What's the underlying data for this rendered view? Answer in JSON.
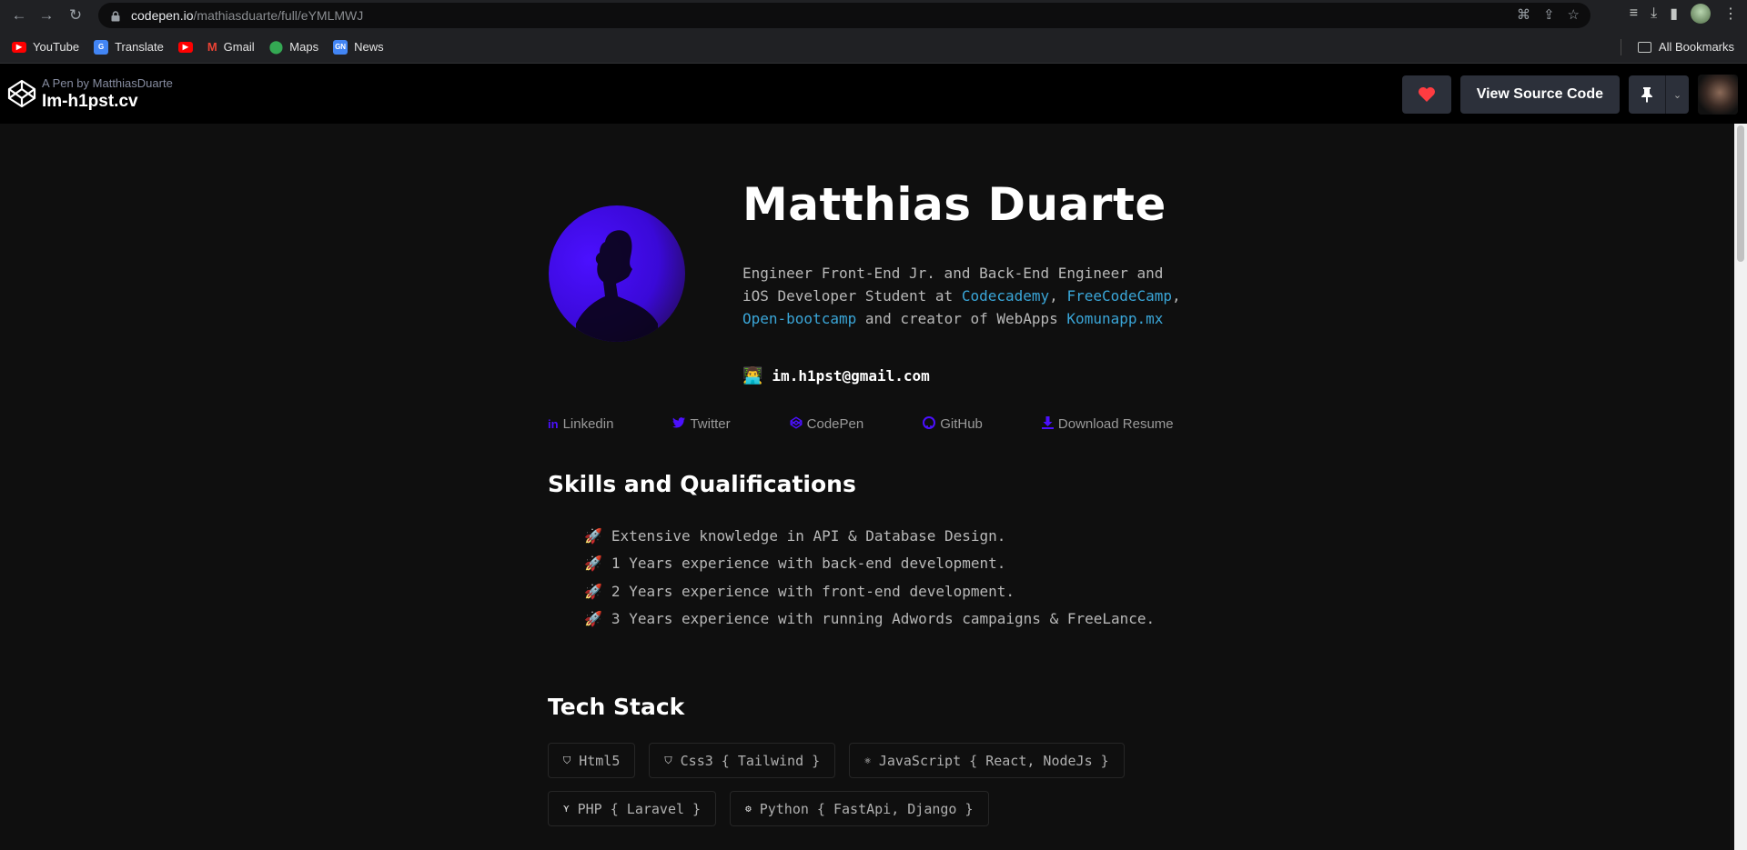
{
  "browser": {
    "url_host": "codepen.io",
    "url_path": "/mathiasduarte/full/eYMLMWJ"
  },
  "bookmarks": {
    "items": [
      {
        "label": "YouTube",
        "color": "#ff0000"
      },
      {
        "label": "Translate",
        "color": "#4285f4"
      },
      {
        "label": "",
        "color": "#ff0000"
      },
      {
        "label": "Gmail",
        "color": "#ea4335"
      },
      {
        "label": "Maps",
        "color": "#34a853"
      },
      {
        "label": "News",
        "color": "#4285f4"
      }
    ],
    "all_label": "All Bookmarks"
  },
  "header": {
    "by_line": "A Pen by MatthiasDuarte",
    "title": "Im-h1pst.cv",
    "view_source": "View Source Code"
  },
  "profile": {
    "name": "Matthias Duarte",
    "bio_1": "Engineer Front-End Jr. and Back-End Engineer and iOS Developer Student at ",
    "bio_link_1": "Codecademy",
    "bio_comma": ",",
    "bio_link_2": "FreeCodeCamp",
    "bio_sep": ", ",
    "bio_link_3": "Open-bootcamp",
    "bio_2": " and creator of WebApps ",
    "bio_link_4": "Komunapp.mx",
    "email": "im.h1pst@gmail.com",
    "accent_color": "#4b10ff",
    "link_color": "#3aa6d8"
  },
  "links": [
    {
      "icon": "linkedin-icon",
      "glyph": "in",
      "label": "Linkedin"
    },
    {
      "icon": "twitter-icon",
      "glyph": "🐦",
      "label": "Twitter"
    },
    {
      "icon": "codepen-icon",
      "glyph": "⬡",
      "label": "CodePen"
    },
    {
      "icon": "github-icon",
      "glyph": "●",
      "label": "GitHub"
    },
    {
      "icon": "download-icon",
      "glyph": "⬇",
      "label": "Download Resume"
    }
  ],
  "skills": {
    "title": "Skills and Qualifications",
    "items": [
      "Extensive knowledge in API & Database Design.",
      "1 Years experience with back-end development.",
      "2 Years experience with front-end development.",
      "3 Years experience with running Adwords campaigns & FreeLance."
    ]
  },
  "tech": {
    "title": "Tech Stack",
    "items": [
      {
        "icon": "html5-icon",
        "glyph": "5",
        "label": "Html5"
      },
      {
        "icon": "css3-icon",
        "glyph": "3",
        "label": "Css3 { Tailwind }"
      },
      {
        "icon": "react-icon",
        "glyph": "⚛",
        "label": "JavaScript { React, NodeJs }"
      },
      {
        "icon": "laravel-icon",
        "glyph": "L",
        "label": "PHP { Laravel }"
      },
      {
        "icon": "python-icon",
        "glyph": "♟",
        "label": "Python { FastApi, Django }"
      }
    ]
  }
}
